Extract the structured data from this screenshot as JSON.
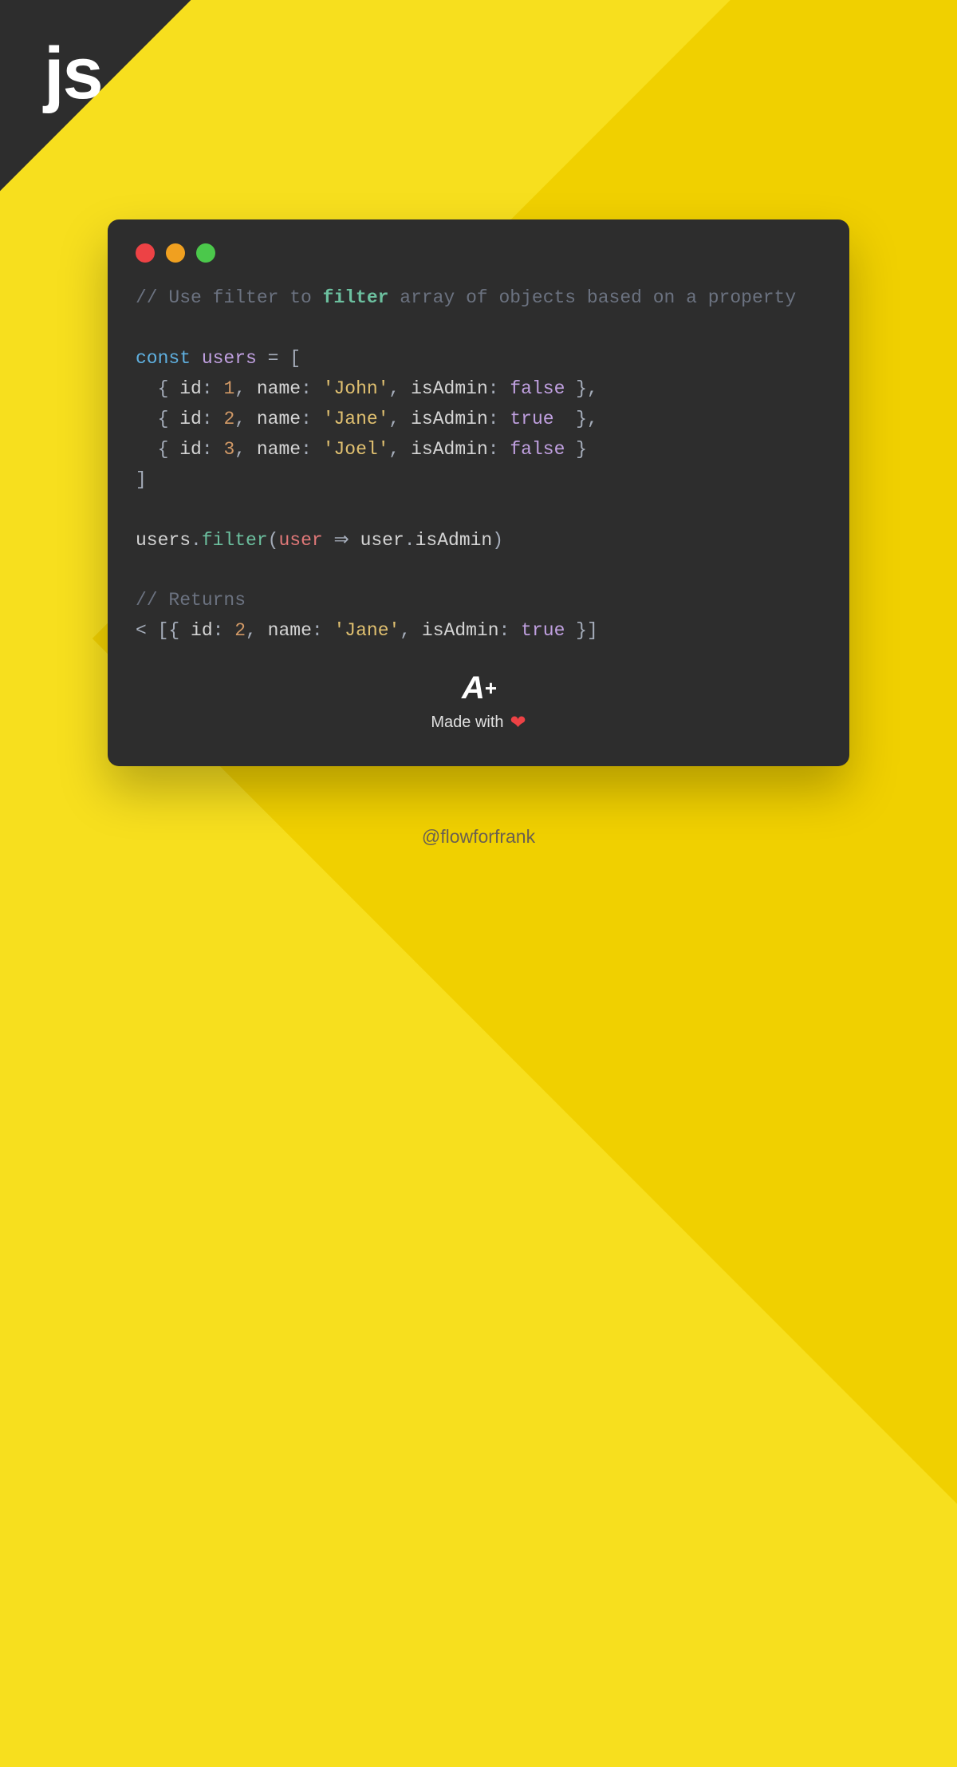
{
  "badge": {
    "text": "js"
  },
  "code": {
    "comment1_pre": "// Use filter to ",
    "comment1_hl": "filter",
    "comment1_post": " array of objects based on a property",
    "const": "const",
    "users_var": "users",
    "equals": " = [",
    "row1": {
      "open": "  { ",
      "idk": "id",
      "c1": ": ",
      "idv": "1",
      "sep1": ", ",
      "namek": "name",
      "c2": ": ",
      "namev": "'John'",
      "sep2": ", ",
      "adk": "isAdmin",
      "c3": ": ",
      "adv": "false",
      "close": " },"
    },
    "row2": {
      "open": "  { ",
      "idk": "id",
      "c1": ": ",
      "idv": "2",
      "sep1": ", ",
      "namek": "name",
      "c2": ": ",
      "namev": "'Jane'",
      "sep2": ", ",
      "adk": "isAdmin",
      "c3": ": ",
      "adv": "true ",
      "close": " },"
    },
    "row3": {
      "open": "  { ",
      "idk": "id",
      "c1": ": ",
      "idv": "3",
      "sep1": ", ",
      "namek": "name",
      "c2": ": ",
      "namev": "'Joel'",
      "sep2": ", ",
      "adk": "isAdmin",
      "c3": ": ",
      "adv": "false",
      "close": " }"
    },
    "close_arr": "]",
    "call": {
      "obj": "users",
      "dot": ".",
      "method": "filter",
      "op": "(",
      "param1": "user",
      "arrow": " ⇒ ",
      "param2": "user",
      "dot2": ".",
      "prop": "isAdmin",
      "cp": ")"
    },
    "comment2": "// Returns",
    "result": {
      "pre": "< [{ ",
      "idk": "id",
      "c1": ": ",
      "idv": "2",
      "sep1": ", ",
      "namek": "name",
      "c2": ": ",
      "namev": "'Jane'",
      "sep2": ", ",
      "adk": "isAdmin",
      "c3": ": ",
      "adv": "true",
      "close": " }]"
    }
  },
  "brand": {
    "logo": "A",
    "plus": "+",
    "made": "Made with"
  },
  "handle": "@flowforfrank"
}
